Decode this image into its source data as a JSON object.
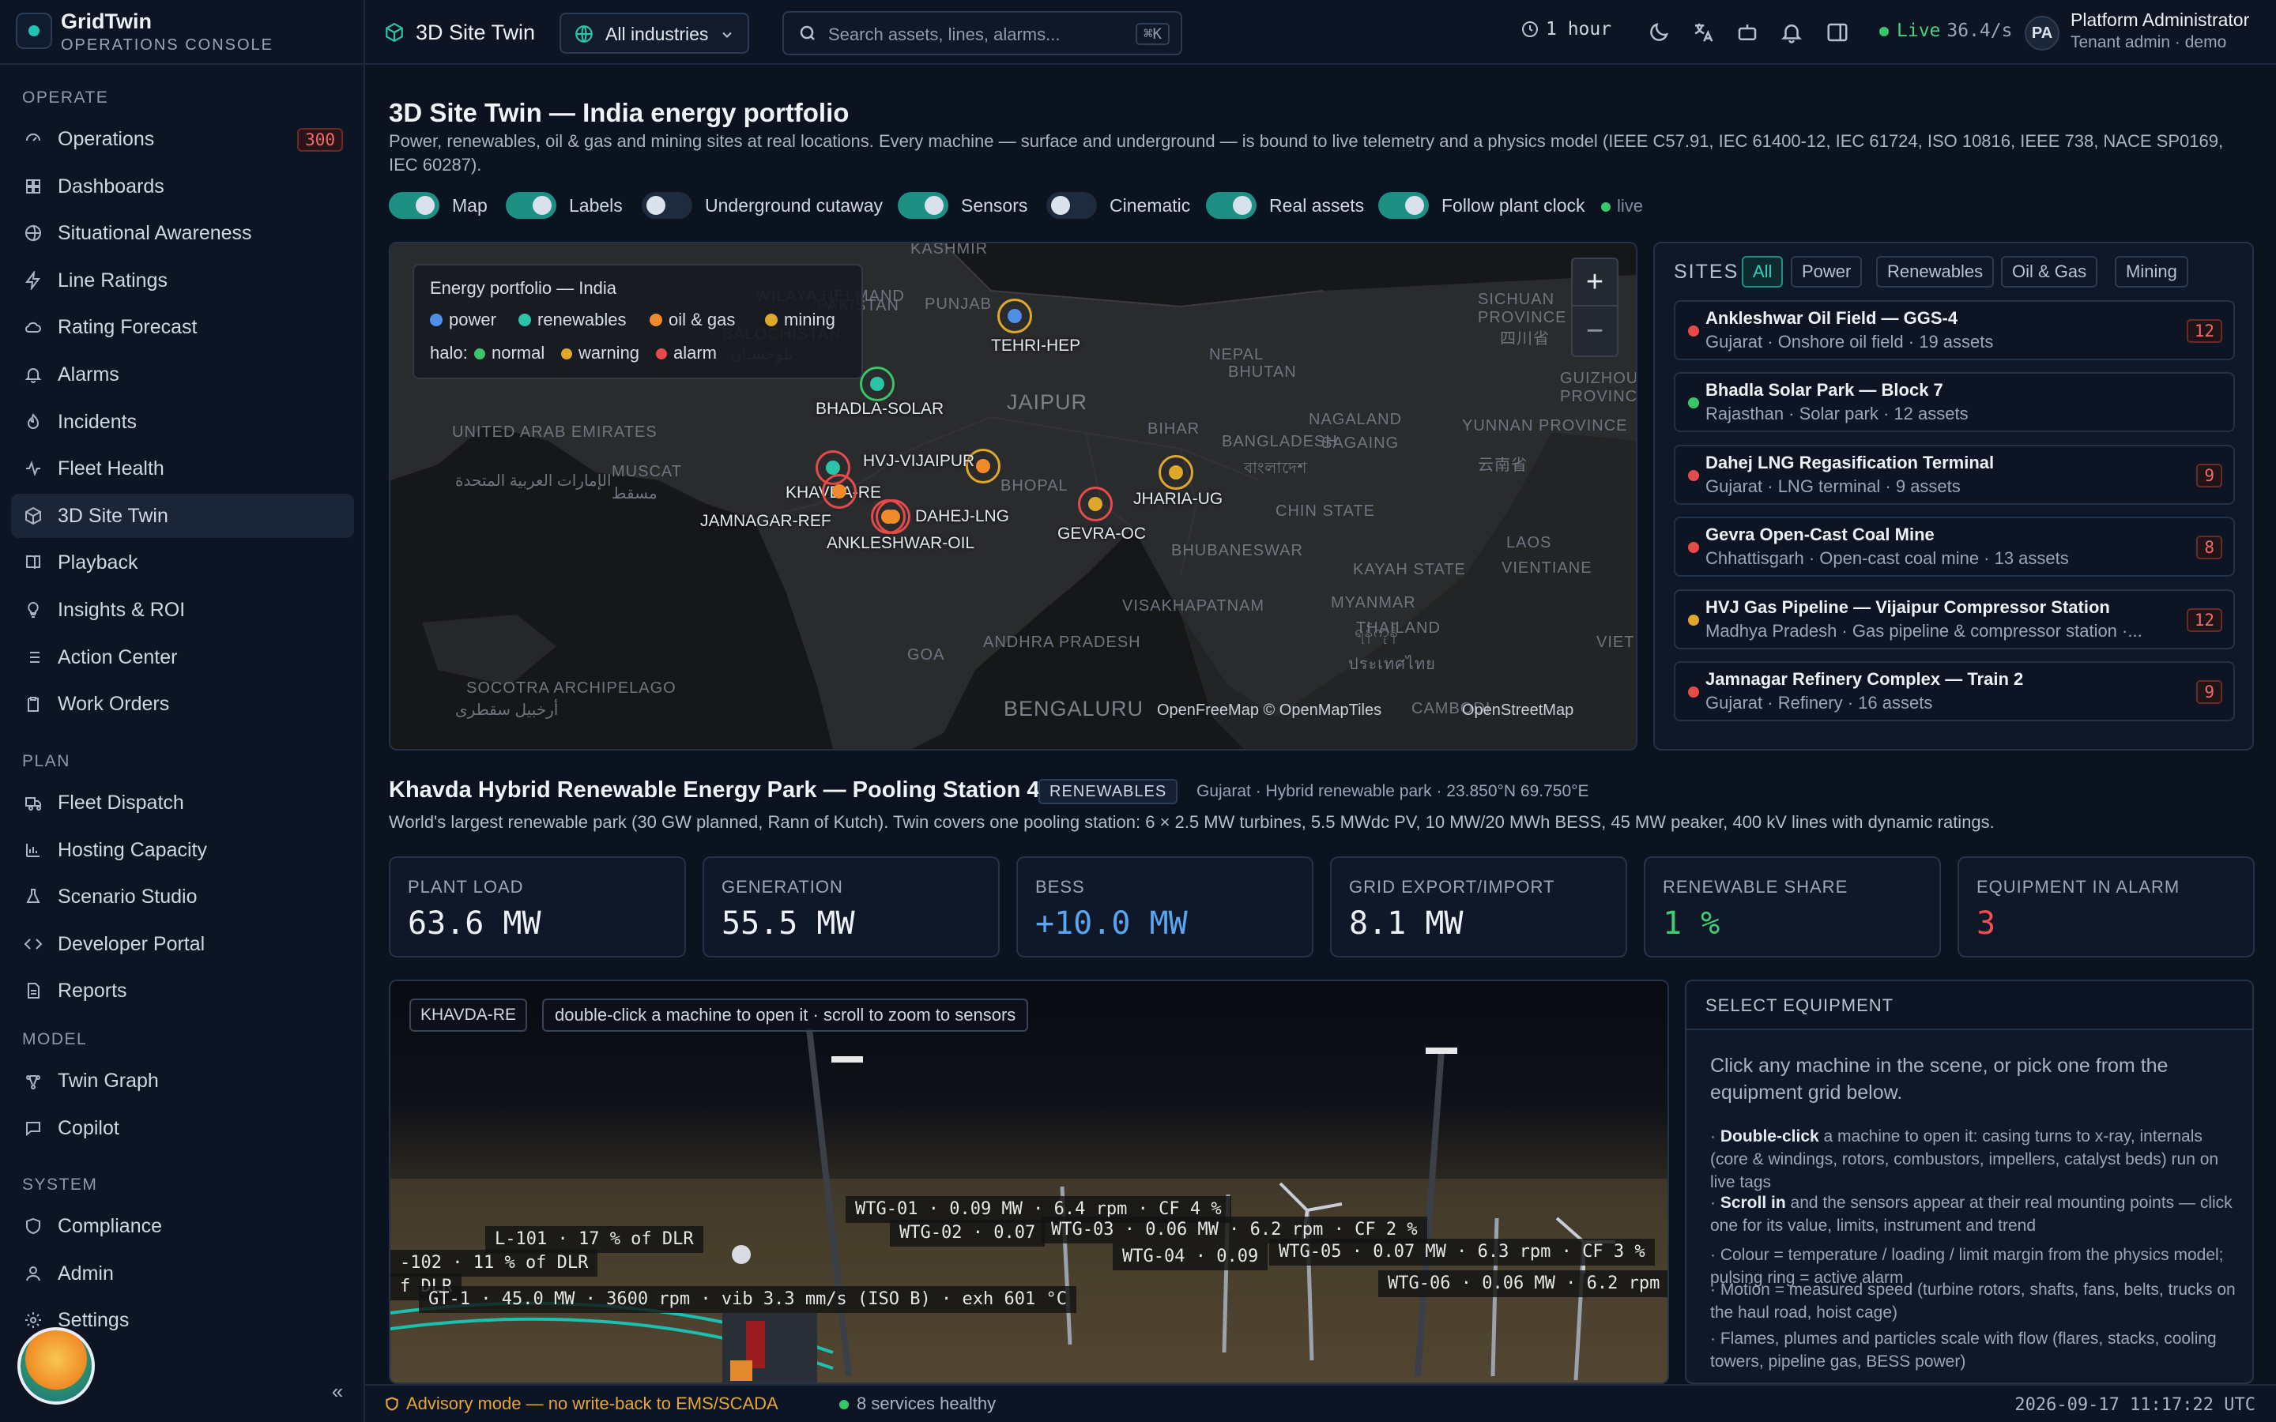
{
  "brand": {
    "name": "GridTwin",
    "subtitle": "OPERATIONS CONSOLE"
  },
  "sidebar": {
    "sections": [
      {
        "title": "OPERATE",
        "items": [
          {
            "label": "Operations",
            "badge": "300",
            "icon": "gauge-icon"
          },
          {
            "label": "Dashboards",
            "icon": "grid-icon"
          },
          {
            "label": "Situational Awareness",
            "icon": "globe-icon"
          },
          {
            "label": "Line Ratings",
            "icon": "bolt-icon"
          },
          {
            "label": "Rating Forecast",
            "icon": "cloud-icon"
          },
          {
            "label": "Alarms",
            "icon": "bell-icon"
          },
          {
            "label": "Incidents",
            "icon": "flame-icon"
          },
          {
            "label": "Fleet Health",
            "icon": "pulse-icon"
          },
          {
            "label": "3D Site Twin",
            "icon": "cube-icon",
            "active": true
          },
          {
            "label": "Playback",
            "icon": "book-icon"
          },
          {
            "label": "Insights & ROI",
            "icon": "bulb-icon"
          },
          {
            "label": "Action Center",
            "icon": "list-icon"
          },
          {
            "label": "Work Orders",
            "icon": "clipboard-icon"
          }
        ]
      },
      {
        "title": "PLAN",
        "items": [
          {
            "label": "Fleet Dispatch",
            "icon": "truck-icon"
          },
          {
            "label": "Hosting Capacity",
            "icon": "chart-icon"
          },
          {
            "label": "Scenario Studio",
            "icon": "flask-icon"
          },
          {
            "label": "Developer Portal",
            "icon": "code-icon"
          },
          {
            "label": "Reports",
            "icon": "file-icon"
          }
        ]
      },
      {
        "title": "MODEL",
        "items": [
          {
            "label": "Twin Graph",
            "icon": "nodes-icon"
          },
          {
            "label": "Copilot",
            "icon": "chat-icon"
          }
        ]
      },
      {
        "title": "SYSTEM",
        "items": [
          {
            "label": "Compliance",
            "icon": "shield-icon"
          },
          {
            "label": "Admin",
            "icon": "user-icon"
          },
          {
            "label": "Settings",
            "icon": "gear-icon"
          }
        ]
      }
    ]
  },
  "topbar": {
    "title": "3D Site Twin",
    "industry": "All industries",
    "search_placeholder": "Search assets, lines, alarms...",
    "search_shortcut": "⌘K",
    "time_range": "1 hour",
    "live_label": "Live",
    "live_rate": "36.4/s",
    "user_initials": "PA",
    "user_name": "Platform Administrator",
    "user_role": "Tenant admin · demo"
  },
  "page": {
    "title": "3D Site Twin — India energy portfolio",
    "description": "Power, renewables, oil & gas and mining sites at real locations. Every machine — surface and underground — is bound to live telemetry and a physics model (IEEE C57.91, IEC 61400-12, IEC 61724, ISO 10816, IEEE 738, NACE SP0169, IEC 60287).",
    "toggles": [
      {
        "label": "Map",
        "on": true
      },
      {
        "label": "Labels",
        "on": true
      },
      {
        "label": "Underground cutaway",
        "on": false
      },
      {
        "label": "Sensors",
        "on": true
      },
      {
        "label": "Cinematic",
        "on": false
      },
      {
        "label": "Real assets",
        "on": true
      },
      {
        "label": "Follow plant clock",
        "on": true
      }
    ],
    "live_pill": "live"
  },
  "map": {
    "legend_title": "Energy portfolio — India",
    "legend_types": [
      {
        "label": "power",
        "color": "#4f8fe8"
      },
      {
        "label": "renewables",
        "color": "#2cc4a8"
      },
      {
        "label": "oil & gas",
        "color": "#f08a2a"
      },
      {
        "label": "mining",
        "color": "#e0a82a"
      }
    ],
    "halo_label": "halo:",
    "legend_halos": [
      {
        "label": "normal",
        "color": "#3cc46a"
      },
      {
        "label": "warning",
        "color": "#e0a82a"
      },
      {
        "label": "alarm",
        "color": "#e84a4a"
      }
    ],
    "zoom_in": "+",
    "zoom_out": "−",
    "attribution": "OpenFreeMap © OpenMapTiles",
    "attribution2": "OpenStreetMap",
    "places": [
      "PAKISTAN",
      "PUNJAB",
      "KASHMIR",
      "NEPAL",
      "BHUTAN",
      "SICHUAN PROVINCE",
      "四川省",
      "GUIZHOU PROVINCE",
      "YUNNAN PROVINCE",
      "云南省",
      "NAGALAND",
      "SAGAING",
      "BANGLADESH",
      "বাংলাদেশ",
      "BIHAR",
      "UNITED ARAB EMIRATES",
      "الإمارات العربية المتحدة",
      "MUSCAT",
      "مسقط",
      "JAIPUR",
      "BHOPAL",
      "BHUBANESWAR",
      "CHIN STATE",
      "LAOS",
      "KAYAH STATE",
      "VIENTIANE",
      "MYANMAR",
      "THAILAND",
      "ประเทศไทย",
      "VISAKHAPATNAM",
      "ANDHRA PRADESH",
      "GOA",
      "BENGALURU",
      "SOCOTRA ARCHIPELAGO",
      "أرخبيل سقطرى",
      "VIETN",
      "CAMBODI",
      "ရန်ကုန်",
      "BALOCHISTAN",
      "بلوچستان",
      "WILAYA HELMAND"
    ],
    "sites": [
      {
        "label": "TEHRI-HEP",
        "color": "#4f8fe8"
      },
      {
        "label": "BHADLA-SOLAR",
        "color": "#2cc4a8"
      },
      {
        "label": "HVJ-VIJAIPUR",
        "color": "#f08a2a"
      },
      {
        "label": "KHAVDA-RE",
        "color": "#2cc4a8"
      },
      {
        "label": "JAMNAGAR-REF",
        "color": "#f08a2a"
      },
      {
        "label": "DAHEJ-LNG",
        "color": "#f08a2a"
      },
      {
        "label": "ANKLESHWAR-OIL",
        "color": "#f08a2a"
      },
      {
        "label": "GEVRA-OC",
        "color": "#e0a82a"
      },
      {
        "label": "JHARIA-UG",
        "color": "#e0a82a"
      }
    ]
  },
  "sites_panel": {
    "title": "SITES",
    "filters": [
      "All",
      "Power",
      "Renewables",
      "Oil & Gas",
      "Mining"
    ],
    "items": [
      {
        "name": "Ankleshwar Oil Field — GGS-4",
        "meta": "Gujarat · Onshore oil field · 19 assets",
        "count": "12",
        "status_color": "#e84a4a"
      },
      {
        "name": "Bhadla Solar Park — Block 7",
        "meta": "Rajasthan · Solar park · 12 assets",
        "count": "",
        "status_color": "#3cc46a"
      },
      {
        "name": "Dahej LNG Regasification Terminal",
        "meta": "Gujarat · LNG terminal · 9 assets",
        "count": "9",
        "status_color": "#e84a4a"
      },
      {
        "name": "Gevra Open-Cast Coal Mine",
        "meta": "Chhattisgarh · Open-cast coal mine · 13 assets",
        "count": "8",
        "status_color": "#e84a4a"
      },
      {
        "name": "HVJ Gas Pipeline — Vijaipur Compressor Station",
        "meta": "Madhya Pradesh · Gas pipeline & compressor station ·...",
        "count": "12",
        "status_color": "#e0a82a"
      },
      {
        "name": "Jamnagar Refinery Complex — Train 2",
        "meta": "Gujarat · Refinery · 16 assets",
        "count": "9",
        "status_color": "#e84a4a"
      }
    ]
  },
  "site": {
    "title": "Khavda Hybrid Renewable Energy Park — Pooling Station 4",
    "tag": "RENEWABLES",
    "location": "Gujarat · Hybrid renewable park · 23.850°N 69.750°E",
    "description": "World's largest renewable park (30 GW planned, Rann of Kutch). Twin covers one pooling station: 6 × 2.5 MW turbines, 5.5 MWdc PV, 10 MW/20 MWh BESS, 45 MW peaker, 400 kV lines with dynamic ratings."
  },
  "metrics": [
    {
      "label": "PLANT LOAD",
      "value": "63.6 MW",
      "color": "#eef2f7"
    },
    {
      "label": "GENERATION",
      "value": "55.5 MW",
      "color": "#eef2f7"
    },
    {
      "label": "BESS",
      "value": "+10.0 MW",
      "color": "#5aa4f0"
    },
    {
      "label": "GRID EXPORT/IMPORT",
      "value": "8.1 MW",
      "color": "#eef2f7"
    },
    {
      "label": "RENEWABLE SHARE",
      "value": "1 %",
      "color": "#3fcf73"
    },
    {
      "label": "EQUIPMENT IN ALARM",
      "value": "3",
      "color": "#ef4f4f"
    }
  ],
  "scene": {
    "site_tag": "KHAVDA-RE",
    "hint": "double-click a machine to open it · scroll to zoom to sensors",
    "labels": [
      "WTG-01 · 0.09 MW · 6.4 rpm · CF 4 %",
      "WTG-02 · 0.07",
      "WTG-03 · 0.06 MW · 6.2 rpm · CF 2 %",
      "WTG-04 · 0.09",
      "WTG-05 · 0.07 MW · 6.3 rpm · CF 3 %",
      "WTG-06 · 0.06 MW · 6.2 rpm",
      "L-101 · 17 % of DLR",
      "-102 · 11 % of DLR",
      "f DLR",
      "GT-1 · 45.0 MW · 3600 rpm · vib 3.3 mm/s (ISO B) · exh 601 °C"
    ]
  },
  "equipment": {
    "title": "SELECT EQUIPMENT",
    "intro": "Click any machine in the scene, or pick one from the equipment grid below.",
    "notes": [
      {
        "bold": "Double-click",
        "text": " a machine to open it: casing turns to x-ray, internals (core & windings, rotors, combustors, impellers, catalyst beds) run on live tags"
      },
      {
        "bold": "Scroll in",
        "text": " and the sensors appear at their real mounting points — click one for its value, limits, instrument and trend"
      },
      {
        "bold": "",
        "text": "Colour = temperature / loading / limit margin from the physics model; pulsing ring = active alarm"
      },
      {
        "bold": "",
        "text": "Motion = measured speed (turbine rotors, shafts, fans, belts, trucks on the haul road, hoist cage)"
      },
      {
        "bold": "",
        "text": "Flames, plumes and particles scale with flow (flares, stacks, cooling towers, pipeline gas, BESS power)"
      }
    ]
  },
  "footer": {
    "advisory": "Advisory mode — no write-back to EMS/SCADA",
    "services": "8 services healthy",
    "clock": "2026-09-17 11:17:22 UTC"
  }
}
